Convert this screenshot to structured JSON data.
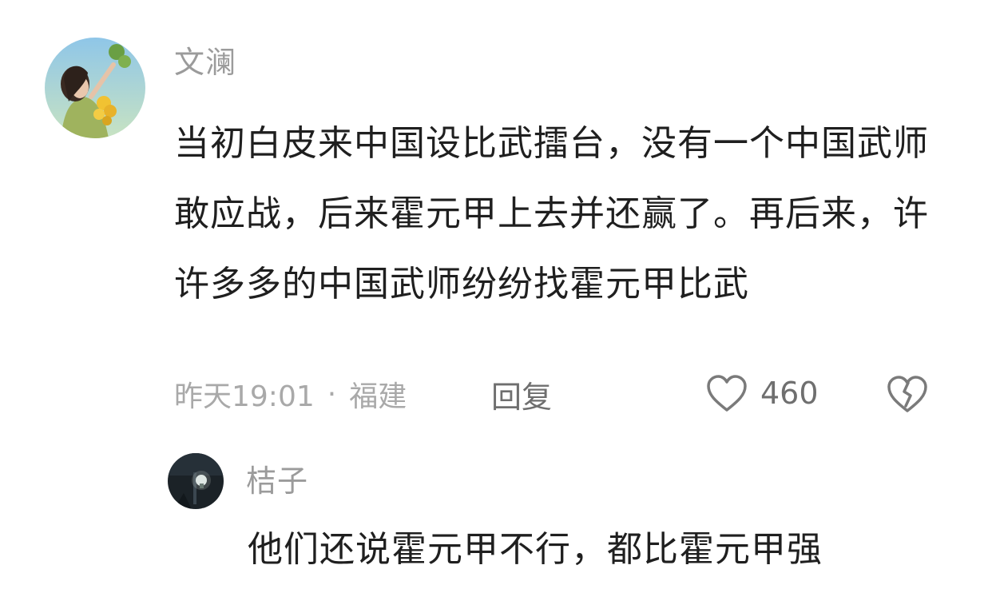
{
  "comment": {
    "username": "文澜",
    "text": "当初白皮来中国设比武擂台，没有一个中国武师敢应战，后来霍元甲上去并还赢了。再后来，许许多多的中国武师纷纷找霍元甲比武",
    "time": "昨天19:01",
    "separator": "·",
    "location": "福建",
    "reply_label": "回复",
    "like_count": "460",
    "avatar_icon": "user-avatar-girl-with-flowers",
    "like_icon": "heart-outline-icon",
    "dislike_icon": "broken-heart-icon"
  },
  "reply": {
    "username": "桔子",
    "text": "他们还说霍元甲不行，都比霍元甲强",
    "avatar_icon": "user-avatar-night-lamp"
  },
  "colors": {
    "background": "#ffffff",
    "username": "#9b9b9b",
    "body_text": "#1f1f1f",
    "meta_text": "#a9a9a9",
    "action_text": "#6f6f6f"
  }
}
